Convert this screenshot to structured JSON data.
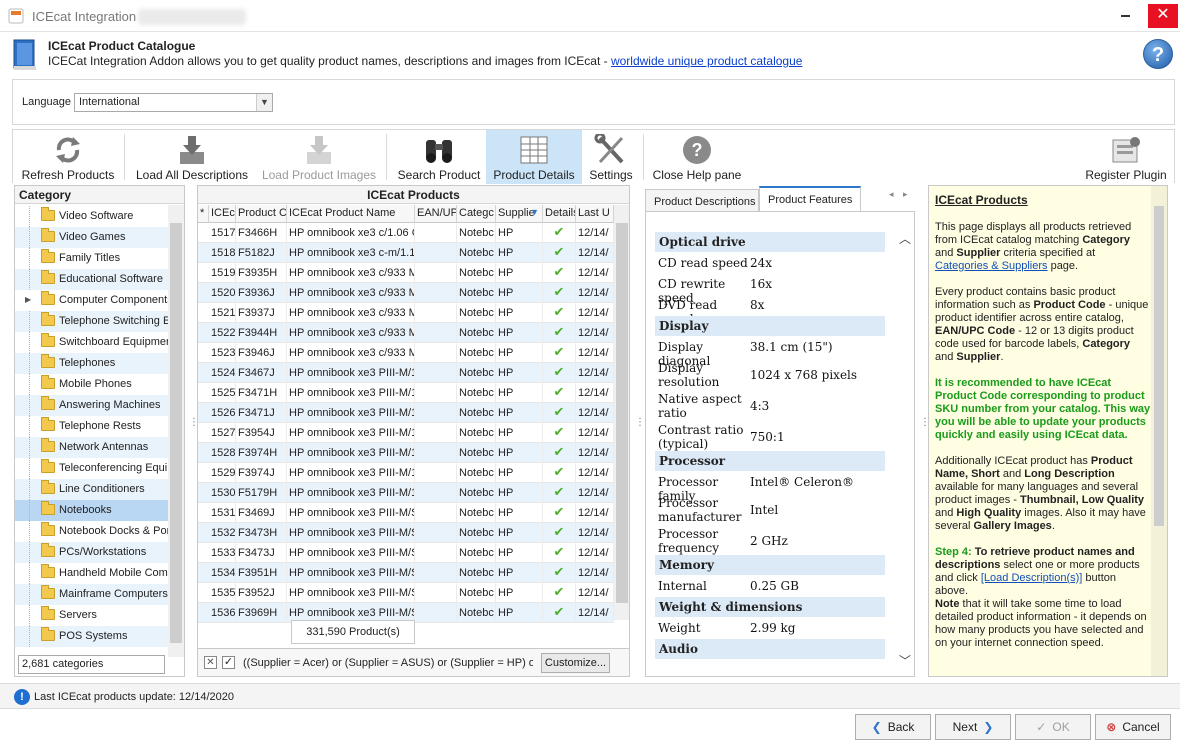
{
  "window": {
    "title": "ICEcat Integration"
  },
  "header": {
    "title": "ICEcat Product Catalogue",
    "description": "ICECat Integration Addon allows you to get quality product names, descriptions and images from ICEcat - ",
    "link": "worldwide unique product catalogue"
  },
  "language": {
    "label": "Language",
    "value": "International"
  },
  "toolbar": {
    "refresh": "Refresh Products",
    "load_desc": "Load All Descriptions",
    "load_images": "Load Product Images",
    "search": "Search Product",
    "details": "Product Details",
    "settings": "Settings",
    "close_help": "Close Help pane",
    "register": "Register Plugin"
  },
  "category": {
    "header": "Category",
    "items": [
      "Video Software",
      "Video Games",
      "Family Titles",
      "Educational Software",
      "Computer Components",
      "Telephone Switching E",
      "Switchboard Equipmer",
      "Telephones",
      "Mobile Phones",
      "Answering Machines",
      "Telephone Rests",
      "Network Antennas",
      "Teleconferencing Equi",
      "Line Conditioners",
      "Notebooks",
      "Notebook Docks & Por",
      "PCs/Workstations",
      "Handheld Mobile Comp",
      "Mainframe Computers",
      "Servers",
      "POS Systems"
    ],
    "count": "2,681 categories"
  },
  "products": {
    "header": "ICEcat Products",
    "columns": [
      "*",
      "ICEc",
      "Product C",
      "ICEcat Product Name",
      "EAN/UP",
      "Categc",
      "Supplie",
      "Details",
      "Last U"
    ],
    "rows": [
      [
        "1517",
        "F3466H",
        "HP omnibook xe3 c/1.06 G",
        "Notebc",
        "HP",
        "12/14/"
      ],
      [
        "1518",
        "F5182J",
        "HP omnibook xe3 c-m/1.1",
        "Notebc",
        "HP",
        "12/14/"
      ],
      [
        "1519",
        "F3935H",
        "HP omnibook xe3 c/933 M",
        "Notebc",
        "HP",
        "12/14/"
      ],
      [
        "1520",
        "F3936J",
        "HP omnibook xe3 c/933 M",
        "Notebc",
        "HP",
        "12/14/"
      ],
      [
        "1521",
        "F3937J",
        "HP omnibook xe3 c/933 M",
        "Notebc",
        "HP",
        "12/14/"
      ],
      [
        "1522",
        "F3944H",
        "HP omnibook xe3 c/933 M",
        "Notebc",
        "HP",
        "12/14/"
      ],
      [
        "1523",
        "F3946J",
        "HP omnibook xe3 c/933 M",
        "Notebc",
        "HP",
        "12/14/"
      ],
      [
        "1524",
        "F3467J",
        "HP omnibook xe3 PIII-M/1",
        "Notebc",
        "HP",
        "12/14/"
      ],
      [
        "1525",
        "F3471H",
        "HP omnibook xe3 PIII-M/1",
        "Notebc",
        "HP",
        "12/14/"
      ],
      [
        "1526",
        "F3471J",
        "HP omnibook xe3 PIII-M/1",
        "Notebc",
        "HP",
        "12/14/"
      ],
      [
        "1527",
        "F3954J",
        "HP omnibook xe3 PIII-M/1",
        "Notebc",
        "HP",
        "12/14/"
      ],
      [
        "1528",
        "F3974H",
        "HP omnibook xe3 PIII-M/1",
        "Notebc",
        "HP",
        "12/14/"
      ],
      [
        "1529",
        "F3974J",
        "HP omnibook xe3 PIII-M/1",
        "Notebc",
        "HP",
        "12/14/"
      ],
      [
        "1530",
        "F5179H",
        "HP omnibook xe3 PIII-M/1",
        "Notebc",
        "HP",
        "12/14/"
      ],
      [
        "1531",
        "F3469J",
        "HP omnibook xe3 PIII-M/S",
        "Notebc",
        "HP",
        "12/14/"
      ],
      [
        "1532",
        "F3473H",
        "HP omnibook xe3 PIII-M/S",
        "Notebc",
        "HP",
        "12/14/"
      ],
      [
        "1533",
        "F3473J",
        "HP omnibook xe3 PIII-M/S",
        "Notebc",
        "HP",
        "12/14/"
      ],
      [
        "1534",
        "F3951H",
        "HP omnibook xe3 PIII-M/S",
        "Notebc",
        "HP",
        "12/14/"
      ],
      [
        "1535",
        "F3952J",
        "HP omnibook xe3 PIII-M/S",
        "Notebc",
        "HP",
        "12/14/"
      ],
      [
        "1536",
        "F3969H",
        "HP omnibook xe3 PIII-M/S",
        "Notebc",
        "HP",
        "12/14/"
      ]
    ],
    "count": "331,590 Product(s)",
    "filter": "((Supplier = Acer) or (Supplier = ASUS) or (Supplier = HP) or",
    "customize": "Customize..."
  },
  "details": {
    "tabs": [
      "Product Descriptions",
      "Product Features"
    ],
    "features": [
      {
        "group": "Optical drive"
      },
      {
        "name": "CD read speed",
        "value": "24x"
      },
      {
        "name": "CD rewrite speed",
        "value": "16x"
      },
      {
        "name": "DVD read speed",
        "value": "8x"
      },
      {
        "group": "Display"
      },
      {
        "name": "Display diagonal",
        "value": "38.1 cm (15\")"
      },
      {
        "name": "Display resolution",
        "value": "1024 x 768 pixels"
      },
      {
        "name": "Native aspect ratio",
        "value": "4:3"
      },
      {
        "name": "Contrast ratio (typical)",
        "value": "750:1"
      },
      {
        "group": "Processor"
      },
      {
        "name": "Processor family",
        "value": "Intel® Celeron®"
      },
      {
        "name": "Processor manufacturer",
        "value": "Intel"
      },
      {
        "name": "Processor frequency",
        "value": "2 GHz"
      },
      {
        "group": "Memory"
      },
      {
        "name": "Internal memory",
        "value": "0.25 GB"
      },
      {
        "group": "Weight & dimensions"
      },
      {
        "name": "Weight",
        "value": "2.99 kg"
      },
      {
        "group": "Audio"
      }
    ]
  },
  "help": {
    "title": "ICEcat Products",
    "p1a": "This page displays all products retrieved from ICEcat catalog matching ",
    "p1b": "Category",
    "p1c": " and ",
    "p1d": "Supplier",
    "p1e": " criteria specified at ",
    "p1link": "Categories & Suppliers",
    "p1f": " page.",
    "p2a": "Every product contains basic product information such as ",
    "p2b": "Product Code",
    "p2c": " - unique product identifier across entire catalog, ",
    "p2d": "EAN/UPC Code",
    "p2e": " - 12 or 13 digits product code used for barcode labels, ",
    "p2f": "Category",
    "p2g": " and ",
    "p2h": "Supplier",
    "p2i": ".",
    "p3": "It is recommended to have ICEcat Product Code corresponding to product SKU number from your catalog. This way you will be able to update your products quickly and easily using ICEcat data.",
    "p4a": "Additionally ICEcat product has ",
    "p4b": "Product Name, Short",
    "p4c": " and ",
    "p4d": "Long Description",
    "p4e": " available for many languages and several product images - ",
    "p4f": "Thumbnail, Low Quality",
    "p4g": " and ",
    "p4h": "High Quality",
    "p4i": " images. Also it may have several ",
    "p4j": "Gallery Images",
    "p4k": ".",
    "step": "Step 4:",
    "s1": " To retrieve product names and descriptions",
    "s2": " select one or more products and click ",
    "slink": "[Load Description(s)]",
    "s3": " button above.",
    "note": "Note",
    "s4": " that it will take some time to load detailed product information - it depends on how many products you have selected and on your internet connection speed."
  },
  "status": {
    "text": "Last ICEcat products update: 12/14/2020"
  },
  "buttons": {
    "back": "Back",
    "next": "Next",
    "ok": "OK",
    "cancel": "Cancel"
  }
}
